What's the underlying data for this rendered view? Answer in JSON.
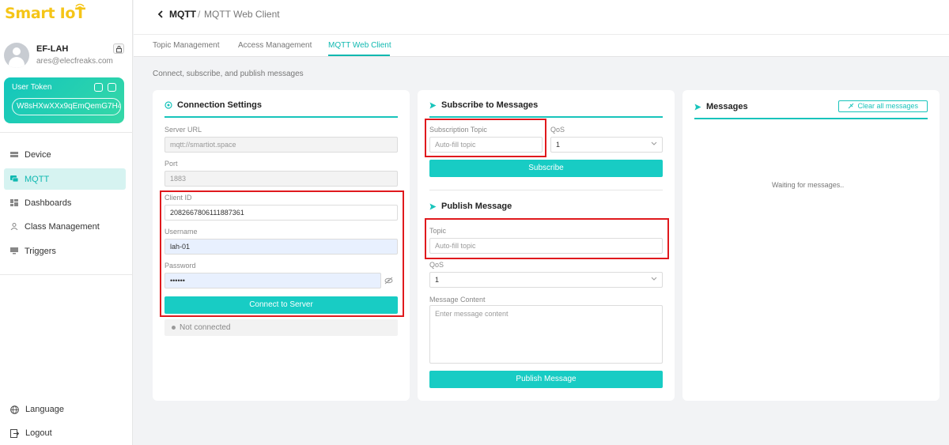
{
  "brand": {
    "logo_text": "Smart IoT",
    "accent": "#18c4bb",
    "highlight": "#e0191d",
    "logo_color": "#f5c518"
  },
  "user": {
    "name": "EF-LAH",
    "email": "ares@elecfreaks.com"
  },
  "token": {
    "label": "User Token",
    "value": "W8sHXwXXx9qEmQemG7H4"
  },
  "nav": {
    "items": [
      {
        "label": "Device",
        "icon": "device-icon"
      },
      {
        "label": "MQTT",
        "icon": "chat-icon",
        "active": true
      },
      {
        "label": "Dashboards",
        "icon": "grid-icon"
      },
      {
        "label": "Class Management",
        "icon": "person-icon"
      },
      {
        "label": "Triggers",
        "icon": "monitor-icon"
      }
    ],
    "language": "Language",
    "logout": "Logout"
  },
  "breadcrumb": {
    "main": "MQTT",
    "sep": "/",
    "sub": "MQTT Web Client"
  },
  "tabs": [
    "Topic Management",
    "Access Management",
    "MQTT Web Client"
  ],
  "page_description": "Connect, subscribe, and publish messages",
  "connection": {
    "title": "Connection Settings",
    "server_url_label": "Server URL",
    "server_url": "mqtt://smartiot.space",
    "port_label": "Port",
    "port": "1883",
    "client_id_label": "Client ID",
    "client_id": "2082667806111887361",
    "username_label": "Username",
    "username": "lah-01",
    "password_label": "Password",
    "password": "••••••",
    "connect_button": "Connect to Server",
    "status": "Not connected"
  },
  "subscribe": {
    "title": "Subscribe to Messages",
    "topic_label": "Subscription Topic",
    "topic_placeholder": "Auto-fill topic",
    "qos_label": "QoS",
    "qos_value": "1",
    "button": "Subscribe"
  },
  "publish": {
    "title": "Publish Message",
    "topic_label": "Topic",
    "topic_placeholder": "Auto-fill topic",
    "qos_label": "QoS",
    "qos_value": "1",
    "content_label": "Message Content",
    "content_placeholder": "Enter message content",
    "button": "Publish Message"
  },
  "messages": {
    "title": "Messages",
    "clear_button": "Clear all messages",
    "empty_text": "Waiting for messages.."
  }
}
